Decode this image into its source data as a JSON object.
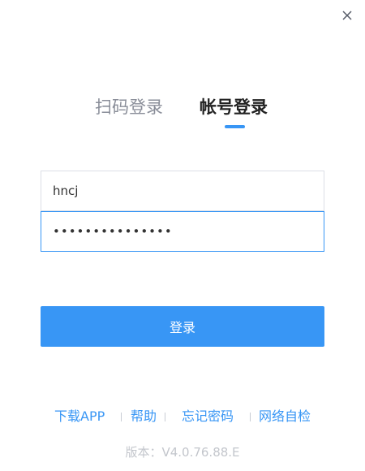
{
  "window": {
    "close_icon": "close-icon"
  },
  "tabs": {
    "qr_login": "扫码登录",
    "account_login": "帐号登录",
    "active": "account_login"
  },
  "form": {
    "username_value": "hncj",
    "password_value": "•••••••••••••••",
    "submit_label": "登录"
  },
  "footer": {
    "links": [
      "下载APP",
      "帮助",
      "忘记密码",
      "网络自检"
    ],
    "version": "版本：V4.0.76.88.E"
  },
  "colors": {
    "accent": "#3896f5",
    "inactive_tab": "#8a8e99",
    "version_text": "#c3c6cc"
  }
}
